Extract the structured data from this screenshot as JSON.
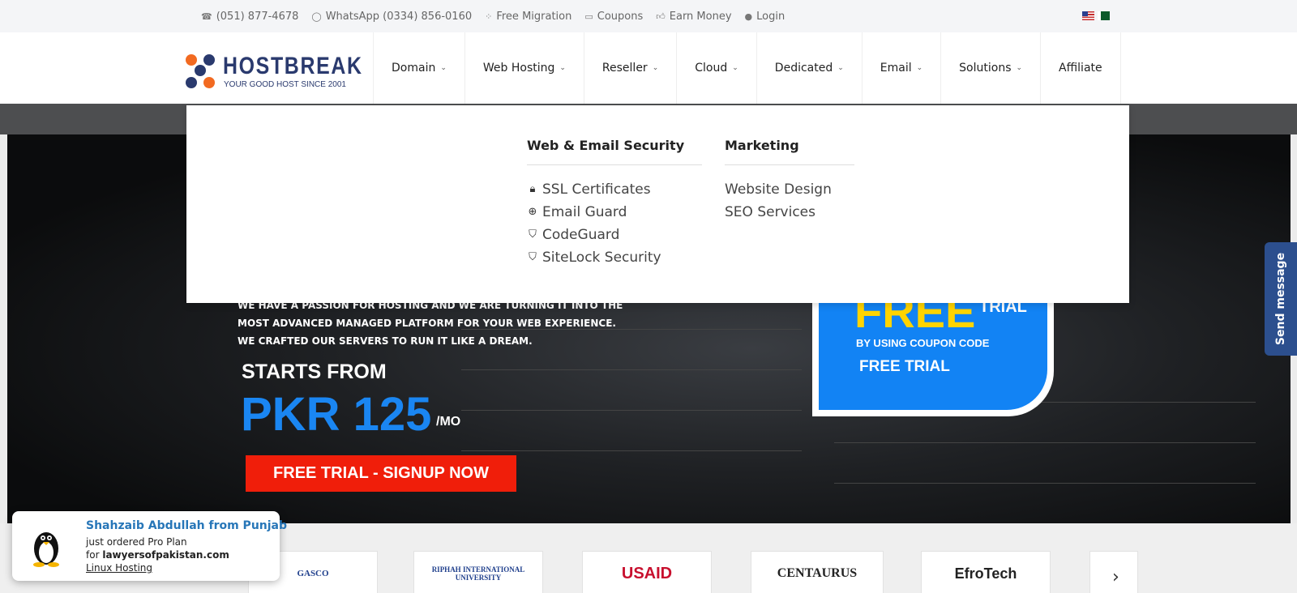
{
  "topbar": {
    "phone": "(051) 877-4678",
    "whatsapp": "WhatsApp (0334) 856-0160",
    "migration": "Free Migration",
    "coupons": "Coupons",
    "earn": "Earn Money",
    "login": "Login"
  },
  "logo": {
    "name": "HOSTBREAK",
    "tagline": "YOUR GOOD HOST SINCE 2001"
  },
  "nav": [
    {
      "label": "Domain",
      "dropdown": true
    },
    {
      "label": "Web Hosting",
      "dropdown": true
    },
    {
      "label": "Reseller",
      "dropdown": true
    },
    {
      "label": "Cloud",
      "dropdown": true
    },
    {
      "label": "Dedicated",
      "dropdown": true
    },
    {
      "label": "Email",
      "dropdown": true
    },
    {
      "label": "Solutions",
      "dropdown": true
    },
    {
      "label": "Affiliate",
      "dropdown": false
    }
  ],
  "dropdown": {
    "security": {
      "title": "Web & Email Security",
      "items": [
        {
          "label": "SSL Certificates",
          "icon": "lock-icon"
        },
        {
          "label": "Email Guard",
          "icon": "lifebuoy-icon"
        },
        {
          "label": "CodeGuard",
          "icon": "shield-icon"
        },
        {
          "label": "SiteLock Security",
          "icon": "shield-icon"
        }
      ]
    },
    "marketing": {
      "title": "Marketing",
      "items": [
        {
          "label": "Website Design"
        },
        {
          "label": "SEO Services"
        }
      ]
    }
  },
  "hero": {
    "line1": "WE HAVE A PASSION FOR HOSTING AND WE ARE TURNING IT INTO THE",
    "line2": "MOST ADVANCED MANAGED PLATFORM FOR YOUR WEB EXPERIENCE.",
    "line3": "WE CRAFTED OUR SERVERS TO RUN IT LIKE A DREAM.",
    "starts_from": "STARTS FROM",
    "price": "PKR 125",
    "per": "/MO",
    "cta": "FREE TRIAL - SIGNUP NOW",
    "promo": {
      "free": "FREE",
      "trial": "TRIAL",
      "coupon_line": "BY USING COUPON CODE",
      "coupon_code": "FREE TRIAL"
    }
  },
  "send_message": "Send message",
  "clients": [
    "GASCO",
    "RIPHAH INTERNATIONAL UNIVERSITY",
    "USAID",
    "CENTAURUS",
    "EfroTech"
  ],
  "toast": {
    "name": "Shahzaib Abdullah from Punjab",
    "action": "just ordered Pro Plan",
    "for_prefix": "for",
    "domain": "lawyersofpakistan.com",
    "product": "Linux Hosting"
  },
  "colors": {
    "brand_navy": "#2a3a6e",
    "brand_orange": "#f26a21",
    "accent_blue": "#1283f4",
    "cta_red": "#f01e0a",
    "free_yellow": "#ffd400"
  }
}
